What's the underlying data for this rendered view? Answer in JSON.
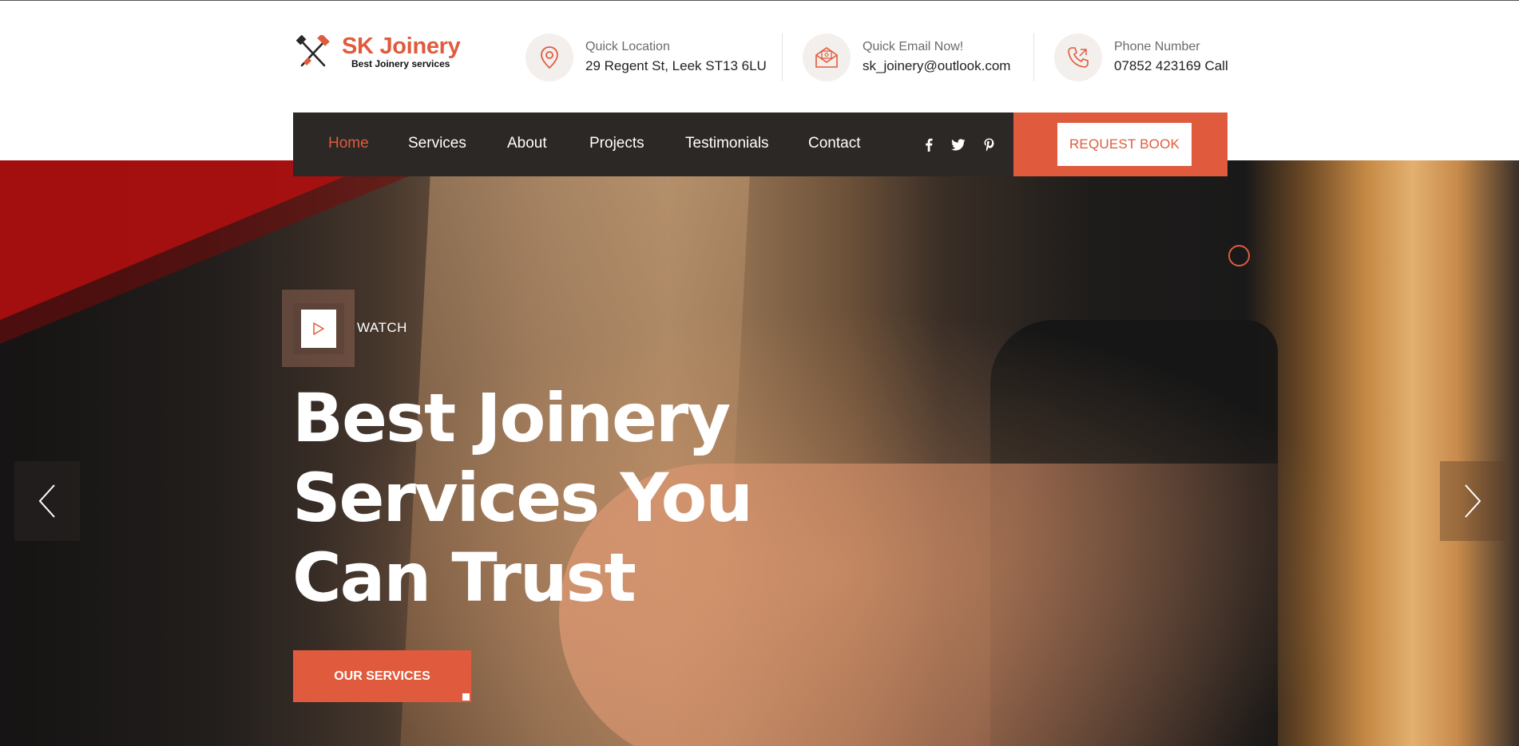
{
  "brand": {
    "name": "SK Joinery",
    "tagline": "Best Joinery services",
    "logo_icon": "saw-and-tools-icon",
    "accent_color": "#e05b3d",
    "dark_color": "#2b2826"
  },
  "contact": {
    "location": {
      "label": "Quick Location",
      "value": "29 Regent St, Leek ST13 6LU",
      "icon": "map-pin-icon"
    },
    "email": {
      "label": "Quick Email Now!",
      "value": "sk_joinery@outlook.com",
      "icon": "envelope-icon"
    },
    "phone": {
      "label": "Phone Number",
      "value": "07852 423169 Call",
      "icon": "phone-icon"
    }
  },
  "nav": {
    "items": [
      {
        "label": "Home",
        "active": true
      },
      {
        "label": "Services",
        "active": false
      },
      {
        "label": "About",
        "active": false
      },
      {
        "label": "Projects",
        "active": false
      },
      {
        "label": "Testimonials",
        "active": false
      },
      {
        "label": "Contact",
        "active": false
      }
    ],
    "social": [
      "facebook-icon",
      "twitter-icon",
      "pinterest-icon"
    ],
    "cta_label": "REQUEST BOOK"
  },
  "hero": {
    "watch_label": "WATCH",
    "title_lines": [
      "Best Joinery",
      "Services You",
      "Can Trust"
    ],
    "button_label": "OUR SERVICES"
  }
}
